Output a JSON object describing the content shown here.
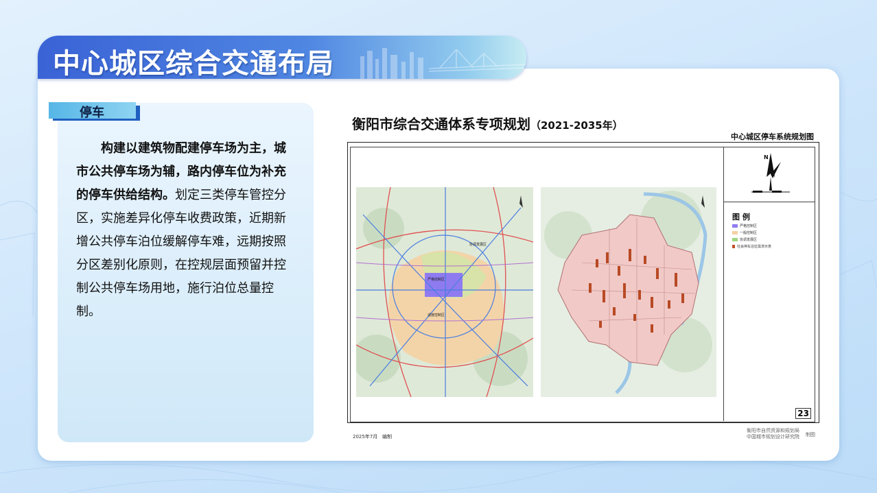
{
  "header": {
    "title": "中心城区综合交通布局"
  },
  "section": {
    "tag": "停车",
    "paragraph_bold": "构建以建筑物配建停车场为主，城市公共停车场为辅，路内停车位为补充的停车供给结构。",
    "paragraph_normal": "划定三类停车管控分区，实施差异化停车收费政策，近期新增公共停车泊位缓解停车难，远期按照分区差别化原则，在控规层面预留并控制公共停车场用地，施行泊位总量控制。"
  },
  "document": {
    "title": "衡阳市综合交通体系专项规划",
    "title_year": "（2021-2035年）",
    "subtitle": "中心城区停车系统规划图",
    "compass_label": "N",
    "legend_title": "图 例",
    "legend": [
      {
        "label": "严格控制区",
        "color": "#8f7bf0"
      },
      {
        "label": "一般控制区",
        "color": "#f5cfa2"
      },
      {
        "label": "协调发展区",
        "color": "#9fd67f"
      },
      {
        "label": "社会停车泊位需求示意",
        "color": "#c0502a"
      }
    ],
    "map_labels": {
      "zone_strict": "严格控制区",
      "zone_general": "适度控制区",
      "zone_coord": "协调发展区"
    },
    "page_number": "23",
    "date": "2025年7月",
    "made_label": "编制",
    "institutions": [
      "衡阳市自然资源和规划局",
      "中国城市规划设计研究院"
    ],
    "made_by": "制图"
  }
}
